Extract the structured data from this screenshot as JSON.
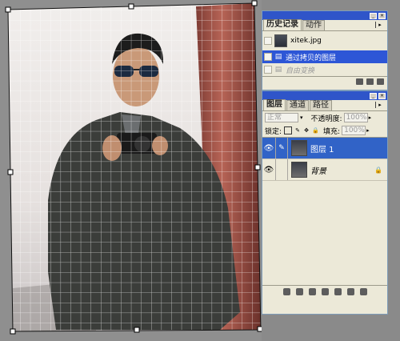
{
  "canvas": {
    "grid_color": "#ffffff",
    "sky_color": "#ece8e6",
    "jacket_color": "#3a3c3a",
    "pole_color": "#b2584b"
  },
  "history_panel": {
    "tabs": [
      "历史记录",
      "动作"
    ],
    "active_tab": "历史记录",
    "snapshot_label": "xitek.jpg",
    "items": [
      {
        "label": "通过拷贝的图层",
        "selected": true,
        "icon": "history-state-icon"
      },
      {
        "label": "自由变换",
        "selected": false,
        "dimmed": true,
        "icon": "history-state-icon"
      }
    ]
  },
  "layers_panel": {
    "tabs": [
      "图层",
      "通道",
      "路径"
    ],
    "active_tab": "图层",
    "blend_mode": "正常",
    "opacity_label": "不透明度:",
    "opacity_value": "100%",
    "lock_label": "锁定:",
    "fill_label": "填充:",
    "fill_value": "100%",
    "layers": [
      {
        "name": "图层 1",
        "selected": true,
        "visible": true
      },
      {
        "name": "背景",
        "selected": false,
        "visible": true,
        "locked": true
      }
    ]
  },
  "colors": {
    "panel_bg": "#ece9d8",
    "selection": "#3163c7",
    "titlebar": "#2f55c9"
  }
}
